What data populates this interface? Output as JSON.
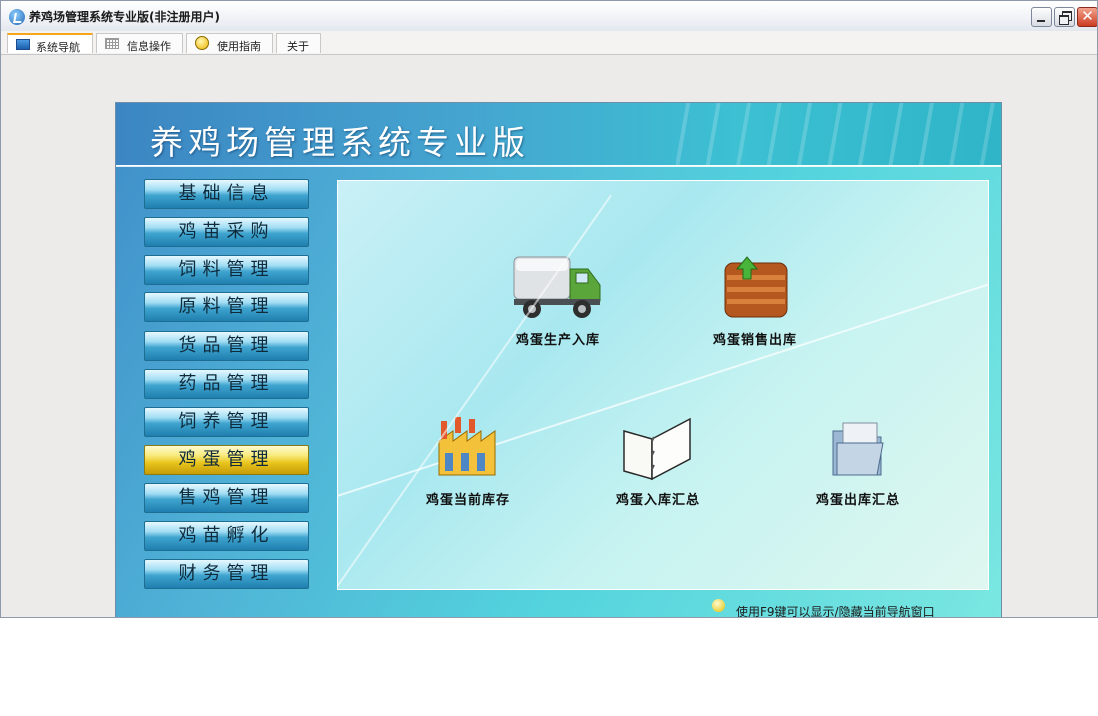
{
  "window": {
    "title": "养鸡场管理系统专业版(非注册用户)",
    "close_glyph": "✕"
  },
  "tabs": [
    {
      "label": "系统导航",
      "icon": "monitor-icon",
      "active": true
    },
    {
      "label": "信息操作",
      "icon": "grid-icon",
      "active": false
    },
    {
      "label": "使用指南",
      "icon": "help-icon",
      "active": false
    },
    {
      "label": "关于",
      "icon": "",
      "active": false
    }
  ],
  "banner": {
    "title": "养鸡场管理系统专业版"
  },
  "nav": {
    "items": [
      {
        "label": "基础信息"
      },
      {
        "label": "鸡苗采购"
      },
      {
        "label": "饲料管理"
      },
      {
        "label": "原料管理"
      },
      {
        "label": "货品管理"
      },
      {
        "label": "药品管理"
      },
      {
        "label": "饲养管理"
      },
      {
        "label": "鸡蛋管理",
        "active": true
      },
      {
        "label": "售鸡管理"
      },
      {
        "label": "鸡苗孵化"
      },
      {
        "label": "财务管理"
      }
    ]
  },
  "tiles": [
    {
      "label": "鸡蛋生产入库",
      "icon": "truck-icon"
    },
    {
      "label": "鸡蛋销售出库",
      "icon": "crate-export-icon"
    },
    {
      "label": "鸡蛋当前库存",
      "icon": "factory-icon"
    },
    {
      "label": "鸡蛋入库汇总",
      "icon": "binder-icon"
    },
    {
      "label": "鸡蛋出库汇总",
      "icon": "folder-icon"
    }
  ],
  "status": {
    "text": "使用F9键可以显示/隐藏当前导航窗口"
  }
}
